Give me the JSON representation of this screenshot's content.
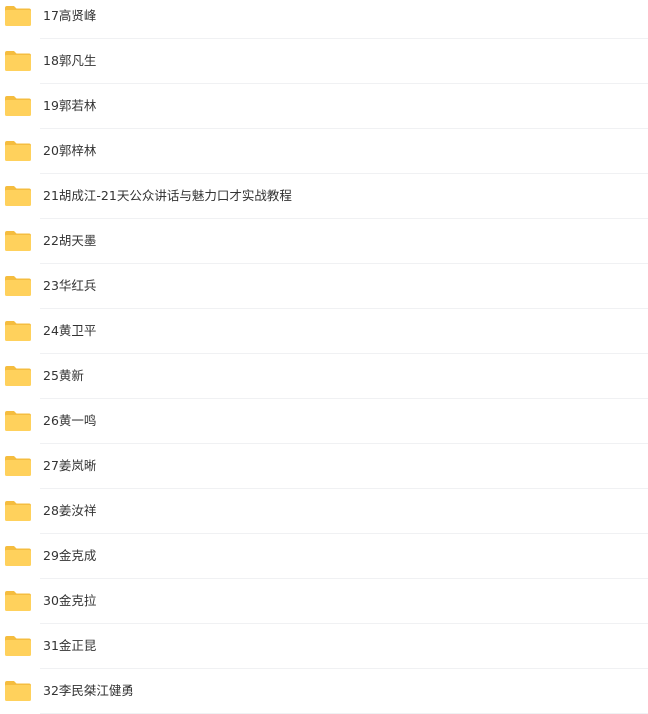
{
  "folder_color": "#ffd15c",
  "folder_tab_color": "#f5bd3f",
  "items": [
    {
      "name": "17高贤峰",
      "icon": "folder-icon"
    },
    {
      "name": "18郭凡生",
      "icon": "folder-icon"
    },
    {
      "name": "19郭若林",
      "icon": "folder-icon"
    },
    {
      "name": "20郭梓林",
      "icon": "folder-icon"
    },
    {
      "name": "21胡成江-21天公众讲话与魅力口才实战教程",
      "icon": "folder-icon"
    },
    {
      "name": "22胡天墨",
      "icon": "folder-icon"
    },
    {
      "name": "23华红兵",
      "icon": "folder-icon"
    },
    {
      "name": "24黄卫平",
      "icon": "folder-icon"
    },
    {
      "name": "25黄新",
      "icon": "folder-icon"
    },
    {
      "name": "26黄一鸣",
      "icon": "folder-icon"
    },
    {
      "name": "27姜岚晰",
      "icon": "folder-icon"
    },
    {
      "name": "28姜汝祥",
      "icon": "folder-icon"
    },
    {
      "name": "29金克成",
      "icon": "folder-icon"
    },
    {
      "name": "30金克拉",
      "icon": "folder-icon"
    },
    {
      "name": "31金正昆",
      "icon": "folder-icon"
    },
    {
      "name": "32李民桀江健勇",
      "icon": "folder-icon"
    }
  ]
}
